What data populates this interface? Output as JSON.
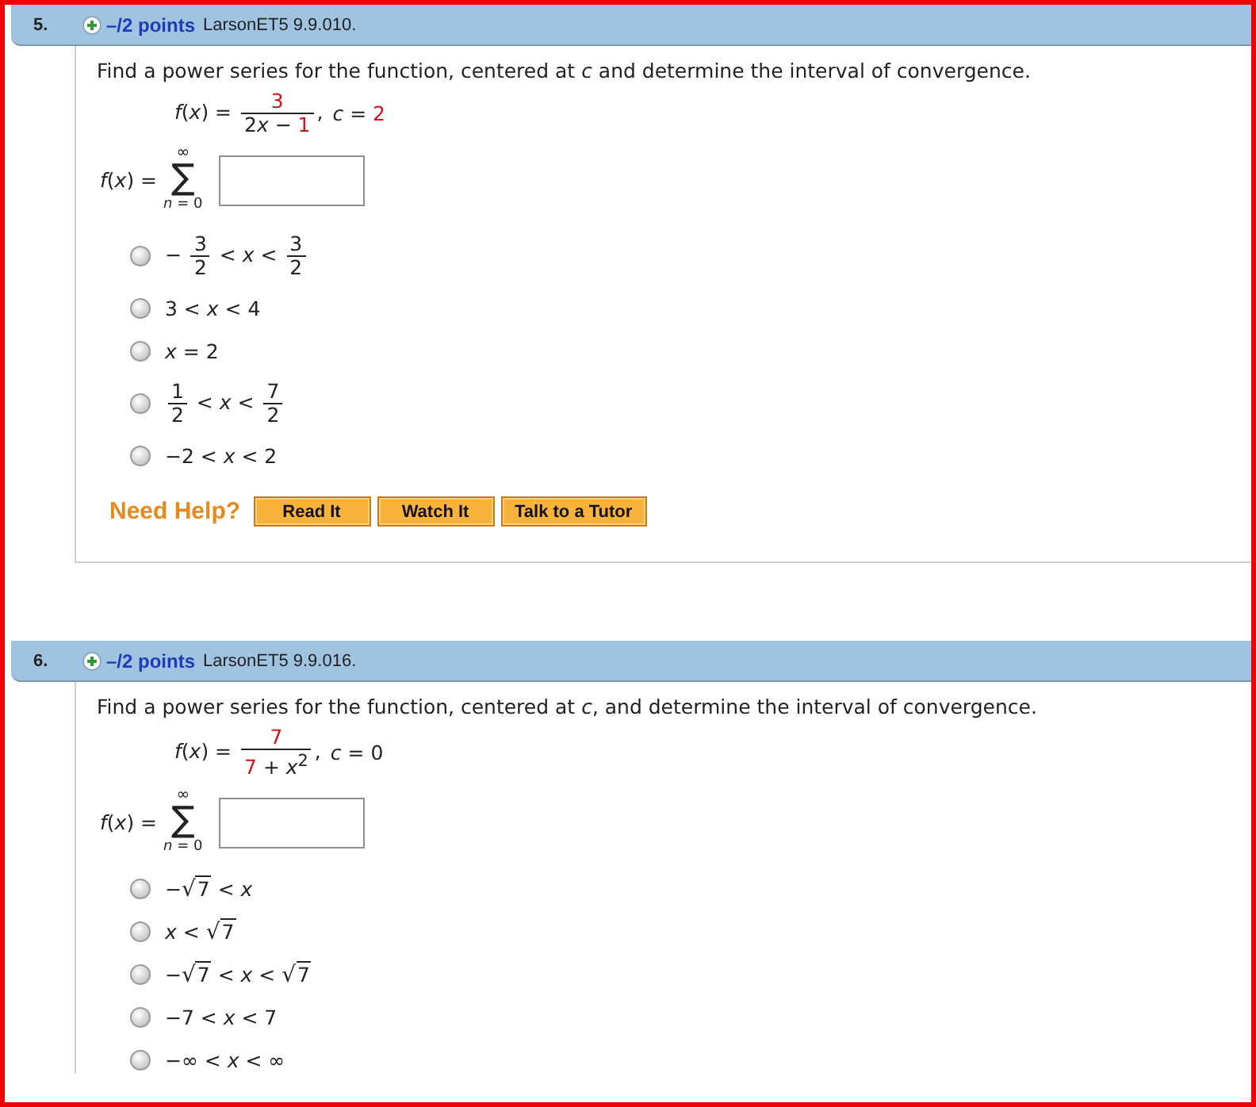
{
  "questions": [
    {
      "number": "5.",
      "points": "–/2 points",
      "source": "LarsonET5 9.9.010.",
      "prompt": "Find a power series for the function, centered at *c* and determine the interval of convergence.",
      "function": {
        "formula": [
          {
            "kind": "text",
            "text": "*f*(*x*) = ",
            "highlighted": false
          },
          {
            "kind": "frac",
            "numerator": [
              {
                "kind": "text",
                "text": "3",
                "highlighted": true
              }
            ],
            "denominator": [
              {
                "kind": "text",
                "text": "2",
                "highlighted": false
              },
              {
                "kind": "text",
                "text": "*x* − ",
                "highlighted": false
              },
              {
                "kind": "text",
                "text": "1",
                "highlighted": true
              }
            ]
          },
          {
            "kind": "text",
            "text": ",",
            "highlighted": false
          }
        ],
        "center": [
          {
            "kind": "text",
            "text": "*c* = ",
            "highlighted": false
          },
          {
            "kind": "text",
            "text": "2",
            "highlighted": true
          }
        ]
      },
      "series": [
        {
          "kind": "text",
          "text": "*f*(*x*) ="
        },
        {
          "kind": "sum",
          "upper": "∞",
          "symbol": "∑",
          "lower": "*n* = 0"
        },
        {
          "kind": "input"
        }
      ],
      "options": [
        {
          "selected": false,
          "label": [
            {
              "kind": "text",
              "text": "− "
            },
            {
              "kind": "frac",
              "numerator": "3",
              "denominator": "2"
            },
            {
              "kind": "text",
              "text": " < *x* < "
            },
            {
              "kind": "frac",
              "numerator": "3",
              "denominator": "2"
            }
          ]
        },
        {
          "selected": false,
          "label": [
            {
              "kind": "text",
              "text": "3 < *x* < 4"
            }
          ]
        },
        {
          "selected": false,
          "label": [
            {
              "kind": "text",
              "text": "*x* = 2"
            }
          ]
        },
        {
          "selected": false,
          "label": [
            {
              "kind": "frac",
              "numerator": "1",
              "denominator": "2"
            },
            {
              "kind": "text",
              "text": " < *x* < "
            },
            {
              "kind": "frac",
              "numerator": "7",
              "denominator": "2"
            }
          ]
        },
        {
          "selected": false,
          "label": [
            {
              "kind": "text",
              "text": "−2 < *x* < 2"
            }
          ]
        }
      ],
      "help": {
        "label": "Need Help?",
        "buttons": [
          "Read It",
          "Watch It",
          "Talk to a Tutor"
        ]
      }
    },
    {
      "number": "6.",
      "points": "–/2 points",
      "source": "LarsonET5 9.9.016.",
      "prompt": "Find a power series for the function, centered at *c*, and determine the interval of convergence.",
      "function": {
        "formula": [
          {
            "kind": "text",
            "text": "*f*(*x*) = ",
            "highlighted": false
          },
          {
            "kind": "frac",
            "numerator": [
              {
                "kind": "text",
                "text": "7",
                "highlighted": true
              }
            ],
            "denominator": [
              {
                "kind": "text",
                "text": "7",
                "highlighted": true
              },
              {
                "kind": "text",
                "text": " + *x*$^{2}$",
                "highlighted": false
              }
            ]
          },
          {
            "kind": "text",
            "text": ",",
            "highlighted": false
          }
        ],
        "center": [
          {
            "kind": "text",
            "text": "*c* = 0",
            "highlighted": false
          }
        ]
      },
      "series": [
        {
          "kind": "text",
          "text": "*f*(*x*) ="
        },
        {
          "kind": "sum",
          "upper": "∞",
          "symbol": "∑",
          "lower": "*n* = 0"
        },
        {
          "kind": "input"
        }
      ],
      "options": [
        {
          "selected": false,
          "label": [
            {
              "kind": "text",
              "text": "−"
            },
            {
              "kind": "sqrt",
              "symbol": "√",
              "radicand": "7"
            },
            {
              "kind": "text",
              "text": " < *x*"
            }
          ]
        },
        {
          "selected": false,
          "label": [
            {
              "kind": "text",
              "text": "*x* < "
            },
            {
              "kind": "sqrt",
              "symbol": "√",
              "radicand": "7"
            }
          ]
        },
        {
          "selected": false,
          "label": [
            {
              "kind": "text",
              "text": "−"
            },
            {
              "kind": "sqrt",
              "symbol": "√",
              "radicand": "7"
            },
            {
              "kind": "text",
              "text": " < *x* < "
            },
            {
              "kind": "sqrt",
              "symbol": "√",
              "radicand": "7"
            }
          ]
        },
        {
          "selected": false,
          "label": [
            {
              "kind": "text",
              "text": "−7 < *x* < 7"
            }
          ]
        },
        {
          "selected": false,
          "label": [
            {
              "kind": "text",
              "text": "−∞ < *x* < ∞"
            }
          ]
        }
      ]
    }
  ]
}
